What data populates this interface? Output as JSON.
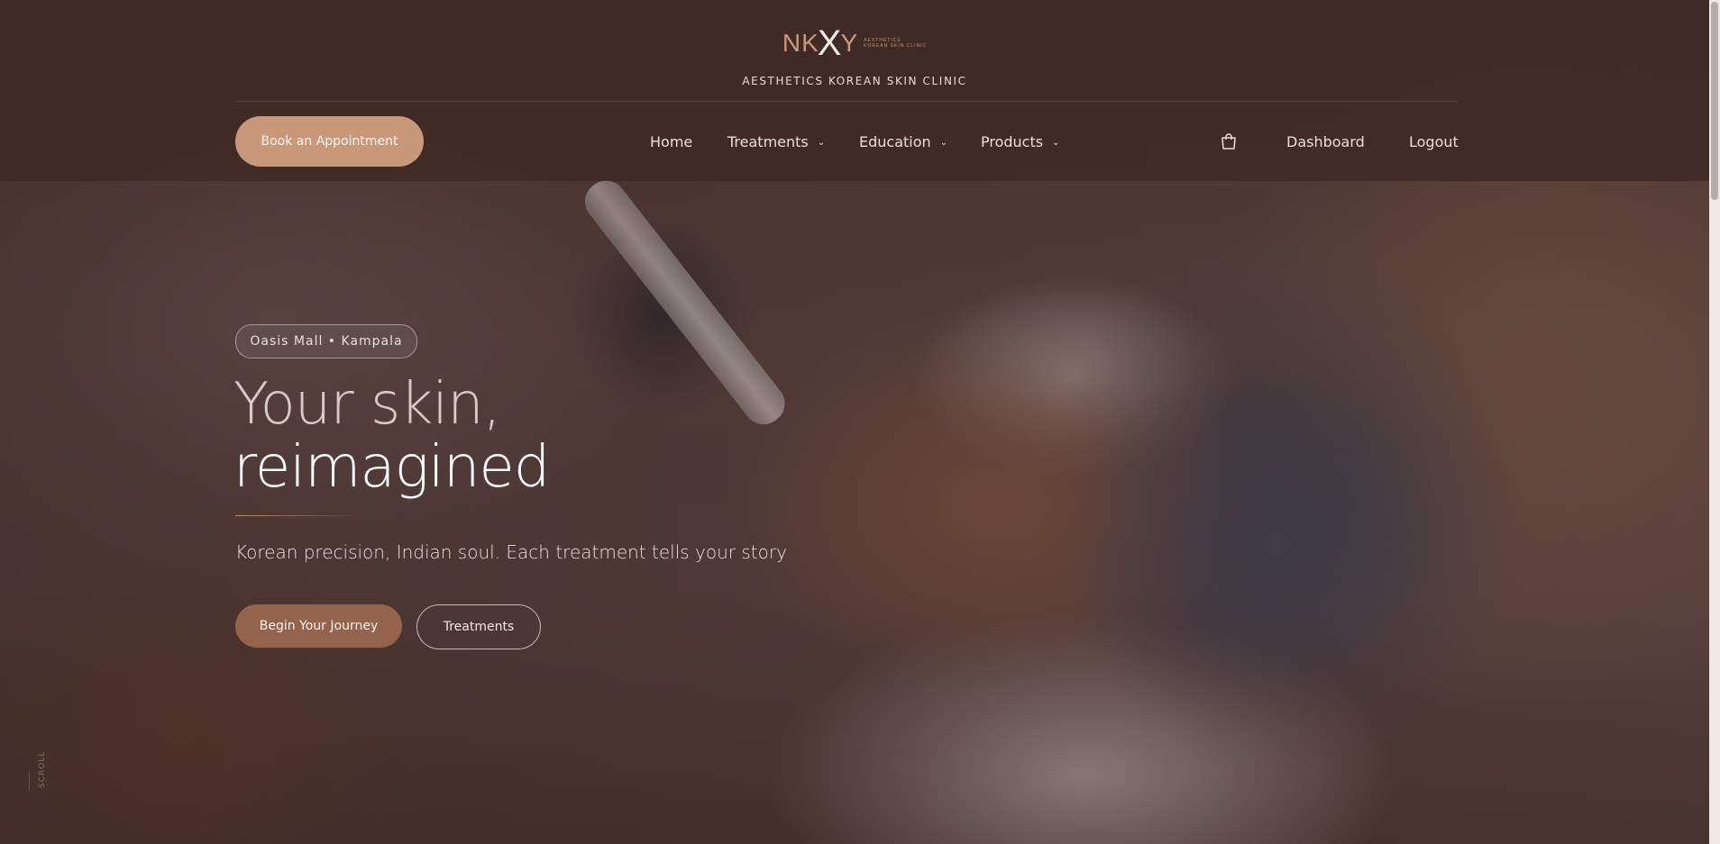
{
  "header": {
    "logo_text_left": "NK",
    "logo_mark": "X",
    "logo_text_right": "Y",
    "logo_small_line1": "AESTHETICS",
    "logo_small_line2": "KOREAN SKIN CLINIC",
    "clinic_name": "AESTHETICS KOREAN SKIN CLINIC",
    "book_label": "Book an Appointment"
  },
  "nav": {
    "home": "Home",
    "treatments": "Treatments",
    "education": "Education",
    "products": "Products",
    "dashboard": "Dashboard",
    "logout": "Logout",
    "chevron": "⌄"
  },
  "hero": {
    "location": "Oasis Mall • Kampala",
    "headline_line1": "Your skin,",
    "headline_line2": "reimagined",
    "tagline": "Korean precision, Indian soul. Each treatment tells your story",
    "primary_cta": "Begin Your Journey",
    "secondary_cta": "Treatments",
    "scroll_label": "SCROLL"
  },
  "icons": {
    "cart": "shopping-bag-icon",
    "dropdown": "chevron-down-icon"
  },
  "colors": {
    "accent": "#c9987a",
    "cta_dark": "#93634b",
    "header_bg": "#402a26"
  }
}
